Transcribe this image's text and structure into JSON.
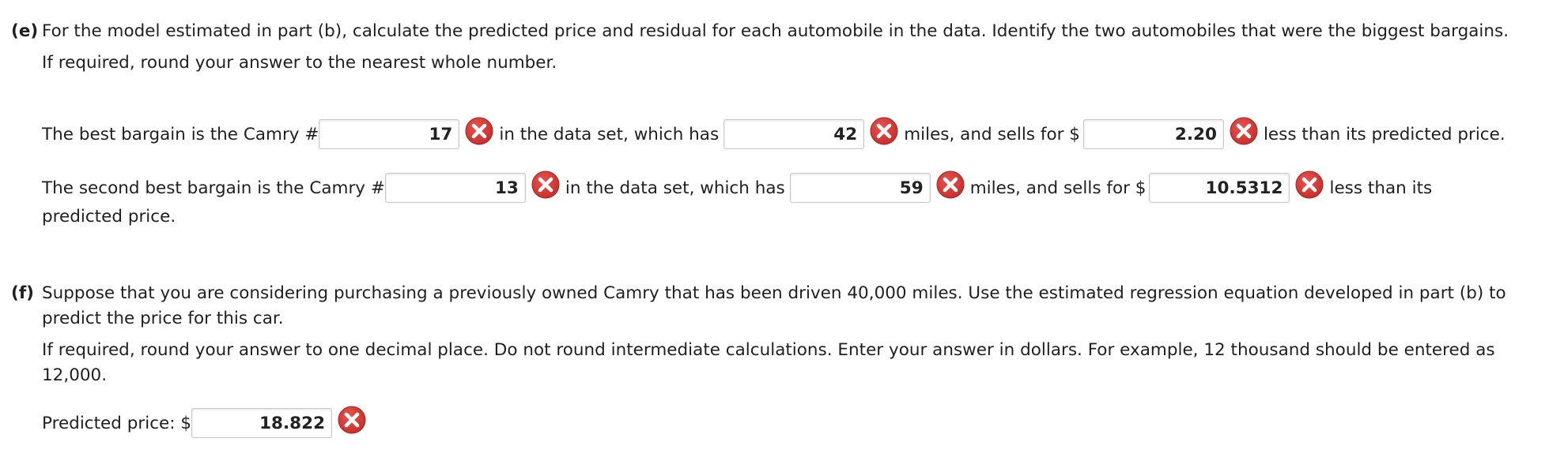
{
  "part_e": {
    "letter": "(e)",
    "question": "For the model estimated in part (b), calculate the predicted price and residual for each automobile in the data. Identify the two automobiles that were the biggest bargains.",
    "note": "If required, round your answer to the nearest whole number.",
    "line1": {
      "prefix": "The best bargain is the Camry #",
      "camry_value": "17",
      "mid1": "in the data set, which has",
      "miles_value": "42",
      "mid2": "miles, and sells for $",
      "amount_value": "2.20",
      "suffix": "less than its predicted price."
    },
    "line2": {
      "prefix": "The second best bargain is the Camry #",
      "camry_value": "13",
      "mid1": "in the data set, which has",
      "miles_value": "59",
      "mid2": "miles, and sells for $",
      "amount_value": "10.5312",
      "suffix": "less than its",
      "suffix_cont": "predicted price."
    }
  },
  "part_f": {
    "letter": "(f)",
    "question": "Suppose that you are considering purchasing a previously owned Camry that has been driven 40,000 miles. Use the estimated regression equation developed in part (b) to predict the price for this car.",
    "note": "If required, round your answer to one decimal place. Do not round intermediate calculations. Enter your answer in dollars. For example, 12 thousand should be entered as 12,000.",
    "label": "Predicted price: $",
    "predicted_value": "18.822"
  },
  "icons": {
    "incorrect": "incorrect-x-icon"
  },
  "colors": {
    "incorrect_fill": "#c9302c",
    "text": "#1f1f1f",
    "field_border": "#c8c8c8"
  }
}
